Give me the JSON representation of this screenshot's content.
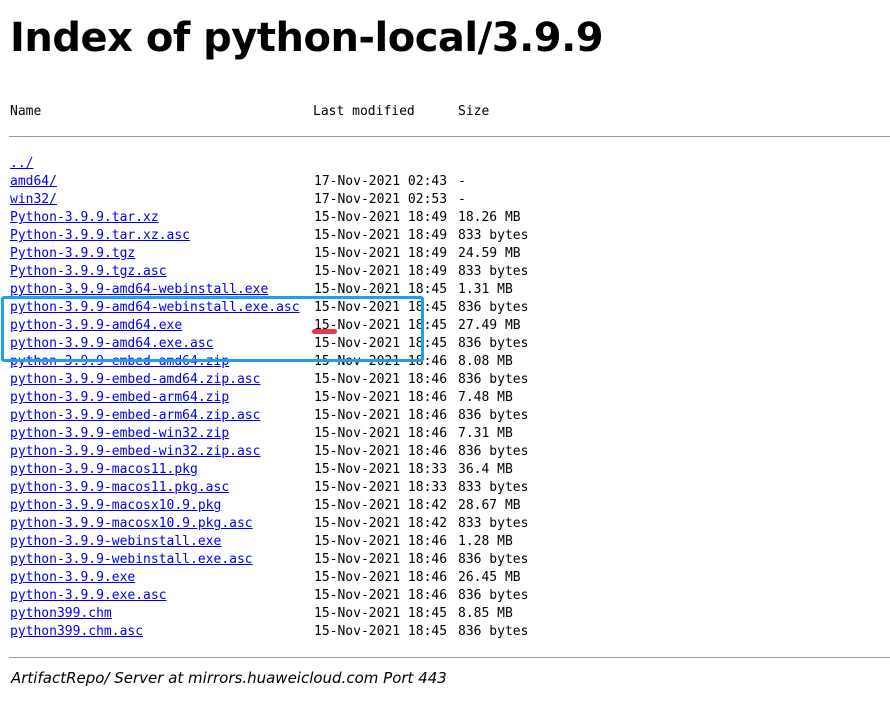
{
  "page": {
    "title": "Index of python-local/3.9.9",
    "columns": {
      "name": "Name",
      "last_modified": "Last modified",
      "size": "Size"
    },
    "footer": "ArtifactRepo/ Server at mirrors.huaweicloud.com Port 443"
  },
  "entries": [
    {
      "name": "../",
      "modified": "",
      "size": ""
    },
    {
      "name": "amd64/",
      "modified": "17-Nov-2021 02:43",
      "size": "-"
    },
    {
      "name": "win32/",
      "modified": "17-Nov-2021 02:53",
      "size": "-"
    },
    {
      "name": "Python-3.9.9.tar.xz",
      "modified": "15-Nov-2021 18:49",
      "size": "18.26 MB"
    },
    {
      "name": "Python-3.9.9.tar.xz.asc",
      "modified": "15-Nov-2021 18:49",
      "size": "833 bytes"
    },
    {
      "name": "Python-3.9.9.tgz",
      "modified": "15-Nov-2021 18:49",
      "size": "24.59 MB"
    },
    {
      "name": "Python-3.9.9.tgz.asc",
      "modified": "15-Nov-2021 18:49",
      "size": "833 bytes"
    },
    {
      "name": "python-3.9.9-amd64-webinstall.exe",
      "modified": "15-Nov-2021 18:45",
      "size": "1.31 MB"
    },
    {
      "name": "python-3.9.9-amd64-webinstall.exe.asc",
      "modified": "15-Nov-2021 18:45",
      "size": "836 bytes"
    },
    {
      "name": "python-3.9.9-amd64.exe",
      "modified": "15-Nov-2021 18:45",
      "size": "27.49 MB"
    },
    {
      "name": "python-3.9.9-amd64.exe.asc",
      "modified": "15-Nov-2021 18:45",
      "size": "836 bytes"
    },
    {
      "name": "python-3.9.9-embed-amd64.zip",
      "modified": "15-Nov-2021 18:46",
      "size": "8.08 MB"
    },
    {
      "name": "python-3.9.9-embed-amd64.zip.asc",
      "modified": "15-Nov-2021 18:46",
      "size": "836 bytes"
    },
    {
      "name": "python-3.9.9-embed-arm64.zip",
      "modified": "15-Nov-2021 18:46",
      "size": "7.48 MB"
    },
    {
      "name": "python-3.9.9-embed-arm64.zip.asc",
      "modified": "15-Nov-2021 18:46",
      "size": "836 bytes"
    },
    {
      "name": "python-3.9.9-embed-win32.zip",
      "modified": "15-Nov-2021 18:46",
      "size": "7.31 MB"
    },
    {
      "name": "python-3.9.9-embed-win32.zip.asc",
      "modified": "15-Nov-2021 18:46",
      "size": "836 bytes"
    },
    {
      "name": "python-3.9.9-macos11.pkg",
      "modified": "15-Nov-2021 18:33",
      "size": "36.4 MB"
    },
    {
      "name": "python-3.9.9-macos11.pkg.asc",
      "modified": "15-Nov-2021 18:33",
      "size": "833 bytes"
    },
    {
      "name": "python-3.9.9-macosx10.9.pkg",
      "modified": "15-Nov-2021 18:42",
      "size": "28.67 MB"
    },
    {
      "name": "python-3.9.9-macosx10.9.pkg.asc",
      "modified": "15-Nov-2021 18:42",
      "size": "833 bytes"
    },
    {
      "name": "python-3.9.9-webinstall.exe",
      "modified": "15-Nov-2021 18:46",
      "size": "1.28 MB"
    },
    {
      "name": "python-3.9.9-webinstall.exe.asc",
      "modified": "15-Nov-2021 18:46",
      "size": "836 bytes"
    },
    {
      "name": "python-3.9.9.exe",
      "modified": "15-Nov-2021 18:46",
      "size": "26.45 MB"
    },
    {
      "name": "python-3.9.9.exe.asc",
      "modified": "15-Nov-2021 18:46",
      "size": "836 bytes"
    },
    {
      "name": "python399.chm",
      "modified": "15-Nov-2021 18:45",
      "size": "8.85 MB"
    },
    {
      "name": "python399.chm.asc",
      "modified": "15-Nov-2021 18:45",
      "size": "836 bytes"
    }
  ],
  "annotations": {
    "highlight_box_color": "#1ea0f0",
    "underline_mark_color": "#e8394a"
  }
}
